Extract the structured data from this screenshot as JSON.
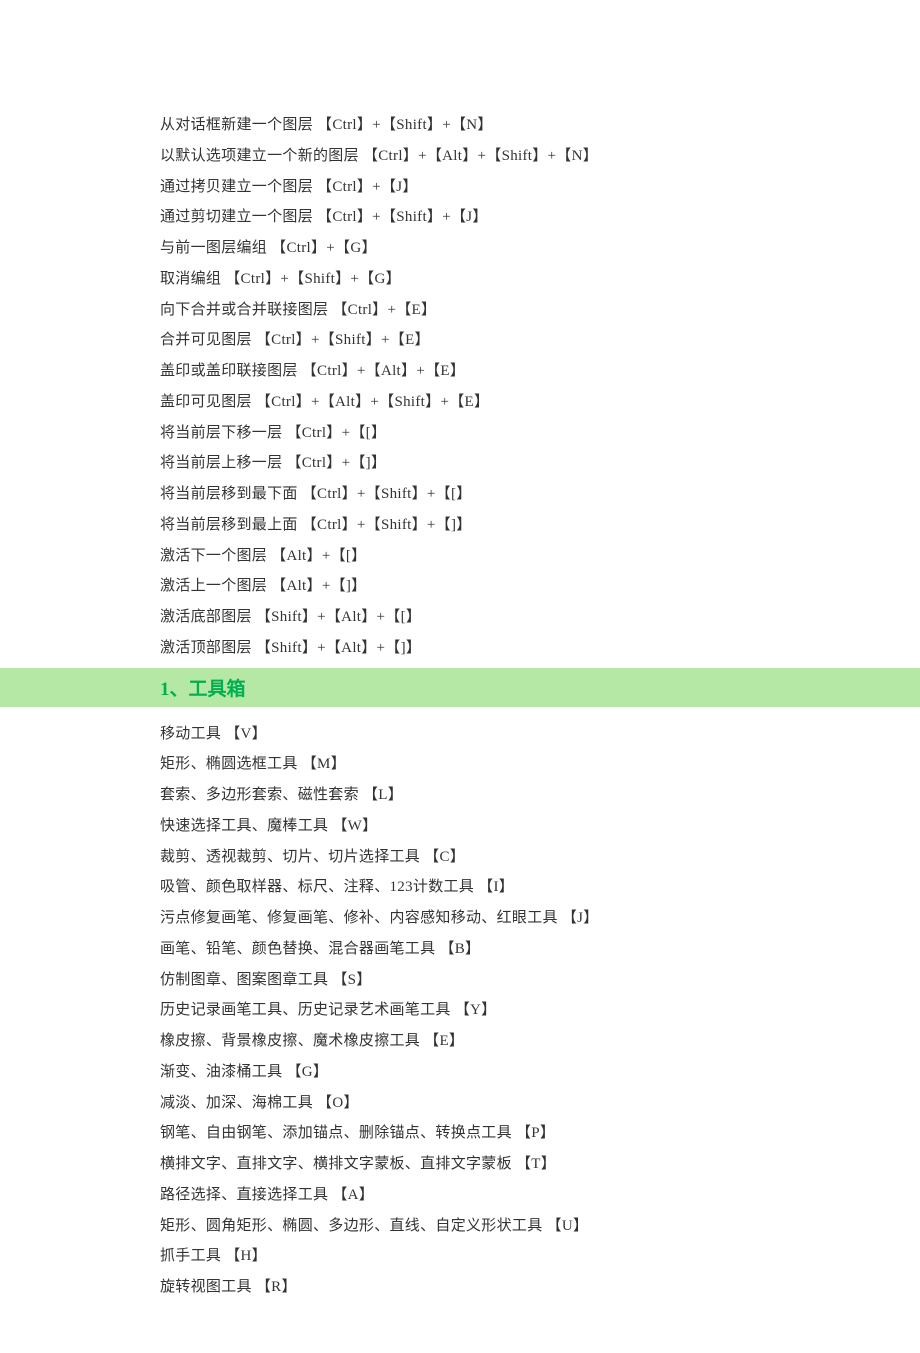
{
  "section1": {
    "lines": [
      "从对话框新建一个图层 【Ctrl】+【Shift】+【N】",
      "以默认选项建立一个新的图层 【Ctrl】+【Alt】+【Shift】+【N】",
      "通过拷贝建立一个图层 【Ctrl】+【J】",
      "通过剪切建立一个图层 【Ctrl】+【Shift】+【J】",
      "与前一图层编组 【Ctrl】+【G】",
      "取消编组 【Ctrl】+【Shift】+【G】",
      "向下合并或合并联接图层 【Ctrl】+【E】",
      "合并可见图层 【Ctrl】+【Shift】+【E】",
      "盖印或盖印联接图层 【Ctrl】+【Alt】+【E】",
      "盖印可见图层 【Ctrl】+【Alt】+【Shift】+【E】",
      "将当前层下移一层 【Ctrl】+【[】",
      "将当前层上移一层 【Ctrl】+【]】",
      "将当前层移到最下面 【Ctrl】+【Shift】+【[】",
      "将当前层移到最上面 【Ctrl】+【Shift】+【]】",
      "激活下一个图层 【Alt】+【[】",
      "激活上一个图层 【Alt】+【]】",
      "激活底部图层 【Shift】+【Alt】+【[】",
      "激活顶部图层 【Shift】+【Alt】+【]】"
    ]
  },
  "header": {
    "title": "1、工具箱"
  },
  "section2": {
    "lines": [
      "移动工具 【V】",
      "矩形、椭圆选框工具 【M】",
      "套索、多边形套索、磁性套索 【L】",
      "快速选择工具、魔棒工具 【W】",
      "裁剪、透视裁剪、切片、切片选择工具 【C】",
      "吸管、颜色取样器、标尺、注释、123计数工具 【I】",
      "污点修复画笔、修复画笔、修补、内容感知移动、红眼工具 【J】",
      "画笔、铅笔、颜色替换、混合器画笔工具 【B】",
      "仿制图章、图案图章工具 【S】",
      "历史记录画笔工具、历史记录艺术画笔工具 【Y】",
      "橡皮擦、背景橡皮擦、魔术橡皮擦工具 【E】",
      "渐变、油漆桶工具 【G】",
      "减淡、加深、海棉工具 【O】",
      "钢笔、自由钢笔、添加锚点、删除锚点、转换点工具 【P】",
      "横排文字、直排文字、横排文字蒙板、直排文字蒙板 【T】",
      "路径选择、直接选择工具 【A】",
      "矩形、圆角矩形、椭圆、多边形、直线、自定义形状工具 【U】",
      "抓手工具 【H】",
      "旋转视图工具 【R】"
    ]
  }
}
